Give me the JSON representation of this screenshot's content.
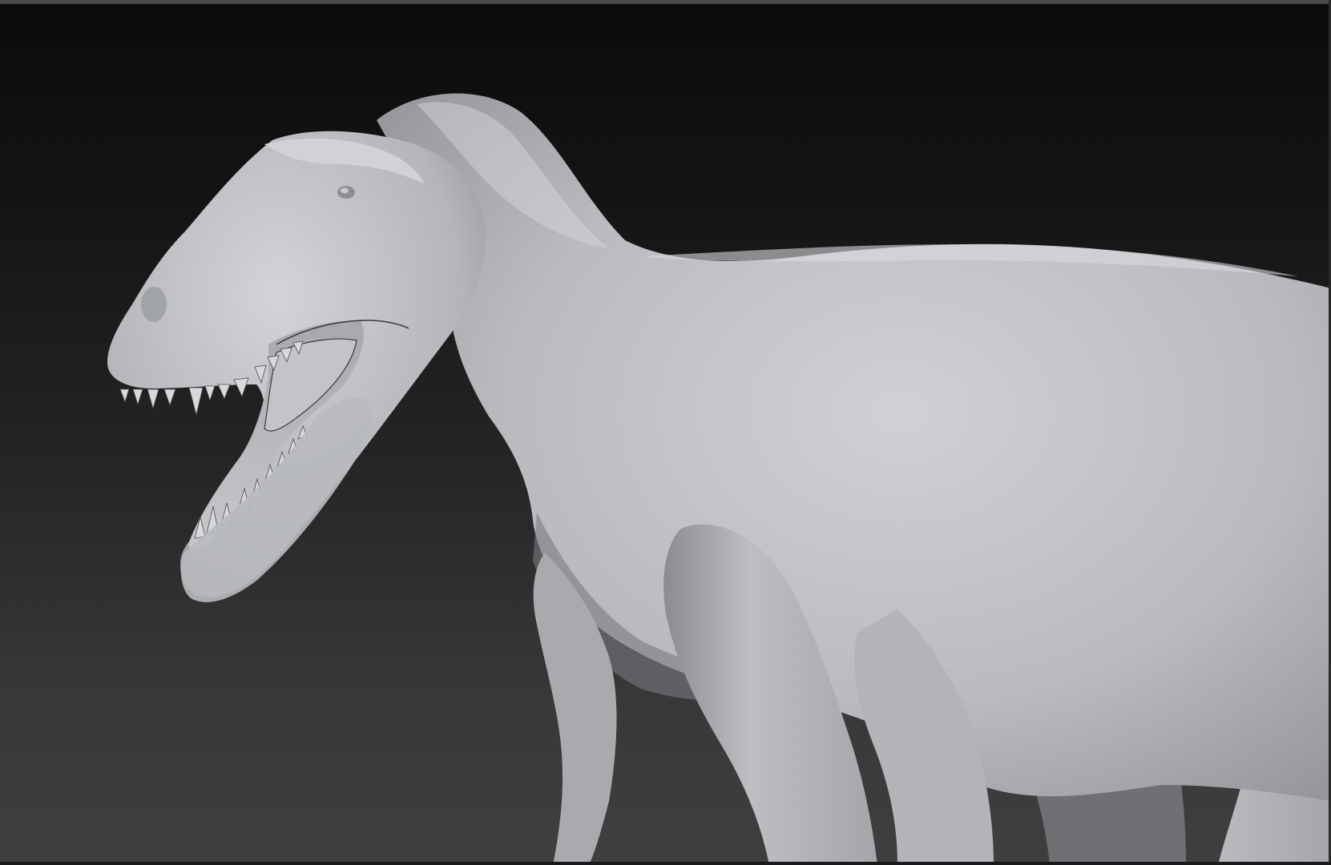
{
  "viewport": {
    "background_top": "#0b0b0b",
    "background_bottom": "#3f3f3f",
    "border_color": "#4a4a4a"
  },
  "model": {
    "material_color": "#bfc1c5",
    "highlight_color": "#d4d6da",
    "shadow_color": "#5a5c60",
    "teeth_color": "#d8d9dc"
  }
}
